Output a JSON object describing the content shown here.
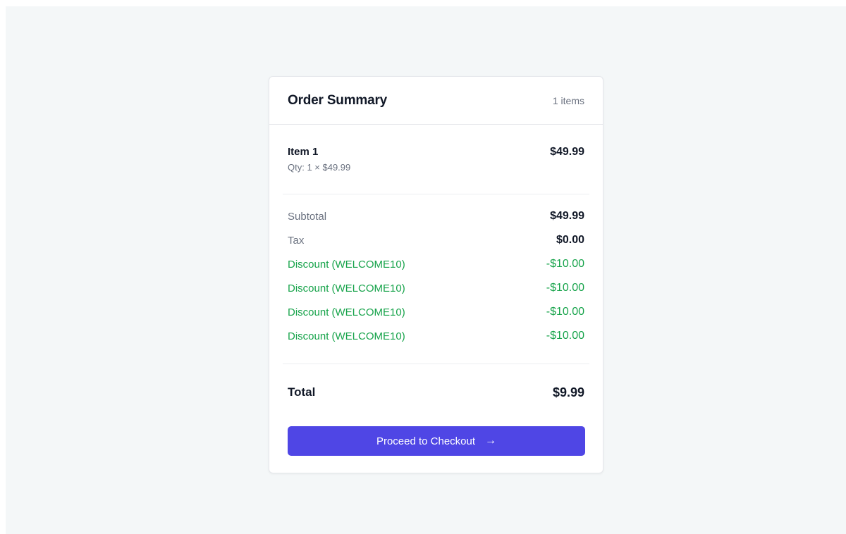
{
  "order_summary": {
    "title": "Order Summary",
    "item_count": "1 items",
    "items": [
      {
        "name": "Item 1",
        "detail": "Qty: 1 × $49.99",
        "price": "$49.99"
      }
    ],
    "subtotal": {
      "label": "Subtotal",
      "value": "$49.99"
    },
    "tax": {
      "label": "Tax",
      "value": "$0.00"
    },
    "discounts": [
      {
        "label": "Discount (WELCOME10)",
        "value": "-$10.00"
      },
      {
        "label": "Discount (WELCOME10)",
        "value": "-$10.00"
      },
      {
        "label": "Discount (WELCOME10)",
        "value": "-$10.00"
      },
      {
        "label": "Discount (WELCOME10)",
        "value": "-$10.00"
      }
    ],
    "total": {
      "label": "Total",
      "value": "$9.99"
    },
    "checkout_label": "Proceed to Checkout",
    "checkout_icon": "arrow-right-icon"
  },
  "colors": {
    "accent": "#4f46e5",
    "discount": "#16a34a",
    "background": "#f4f7f8"
  }
}
